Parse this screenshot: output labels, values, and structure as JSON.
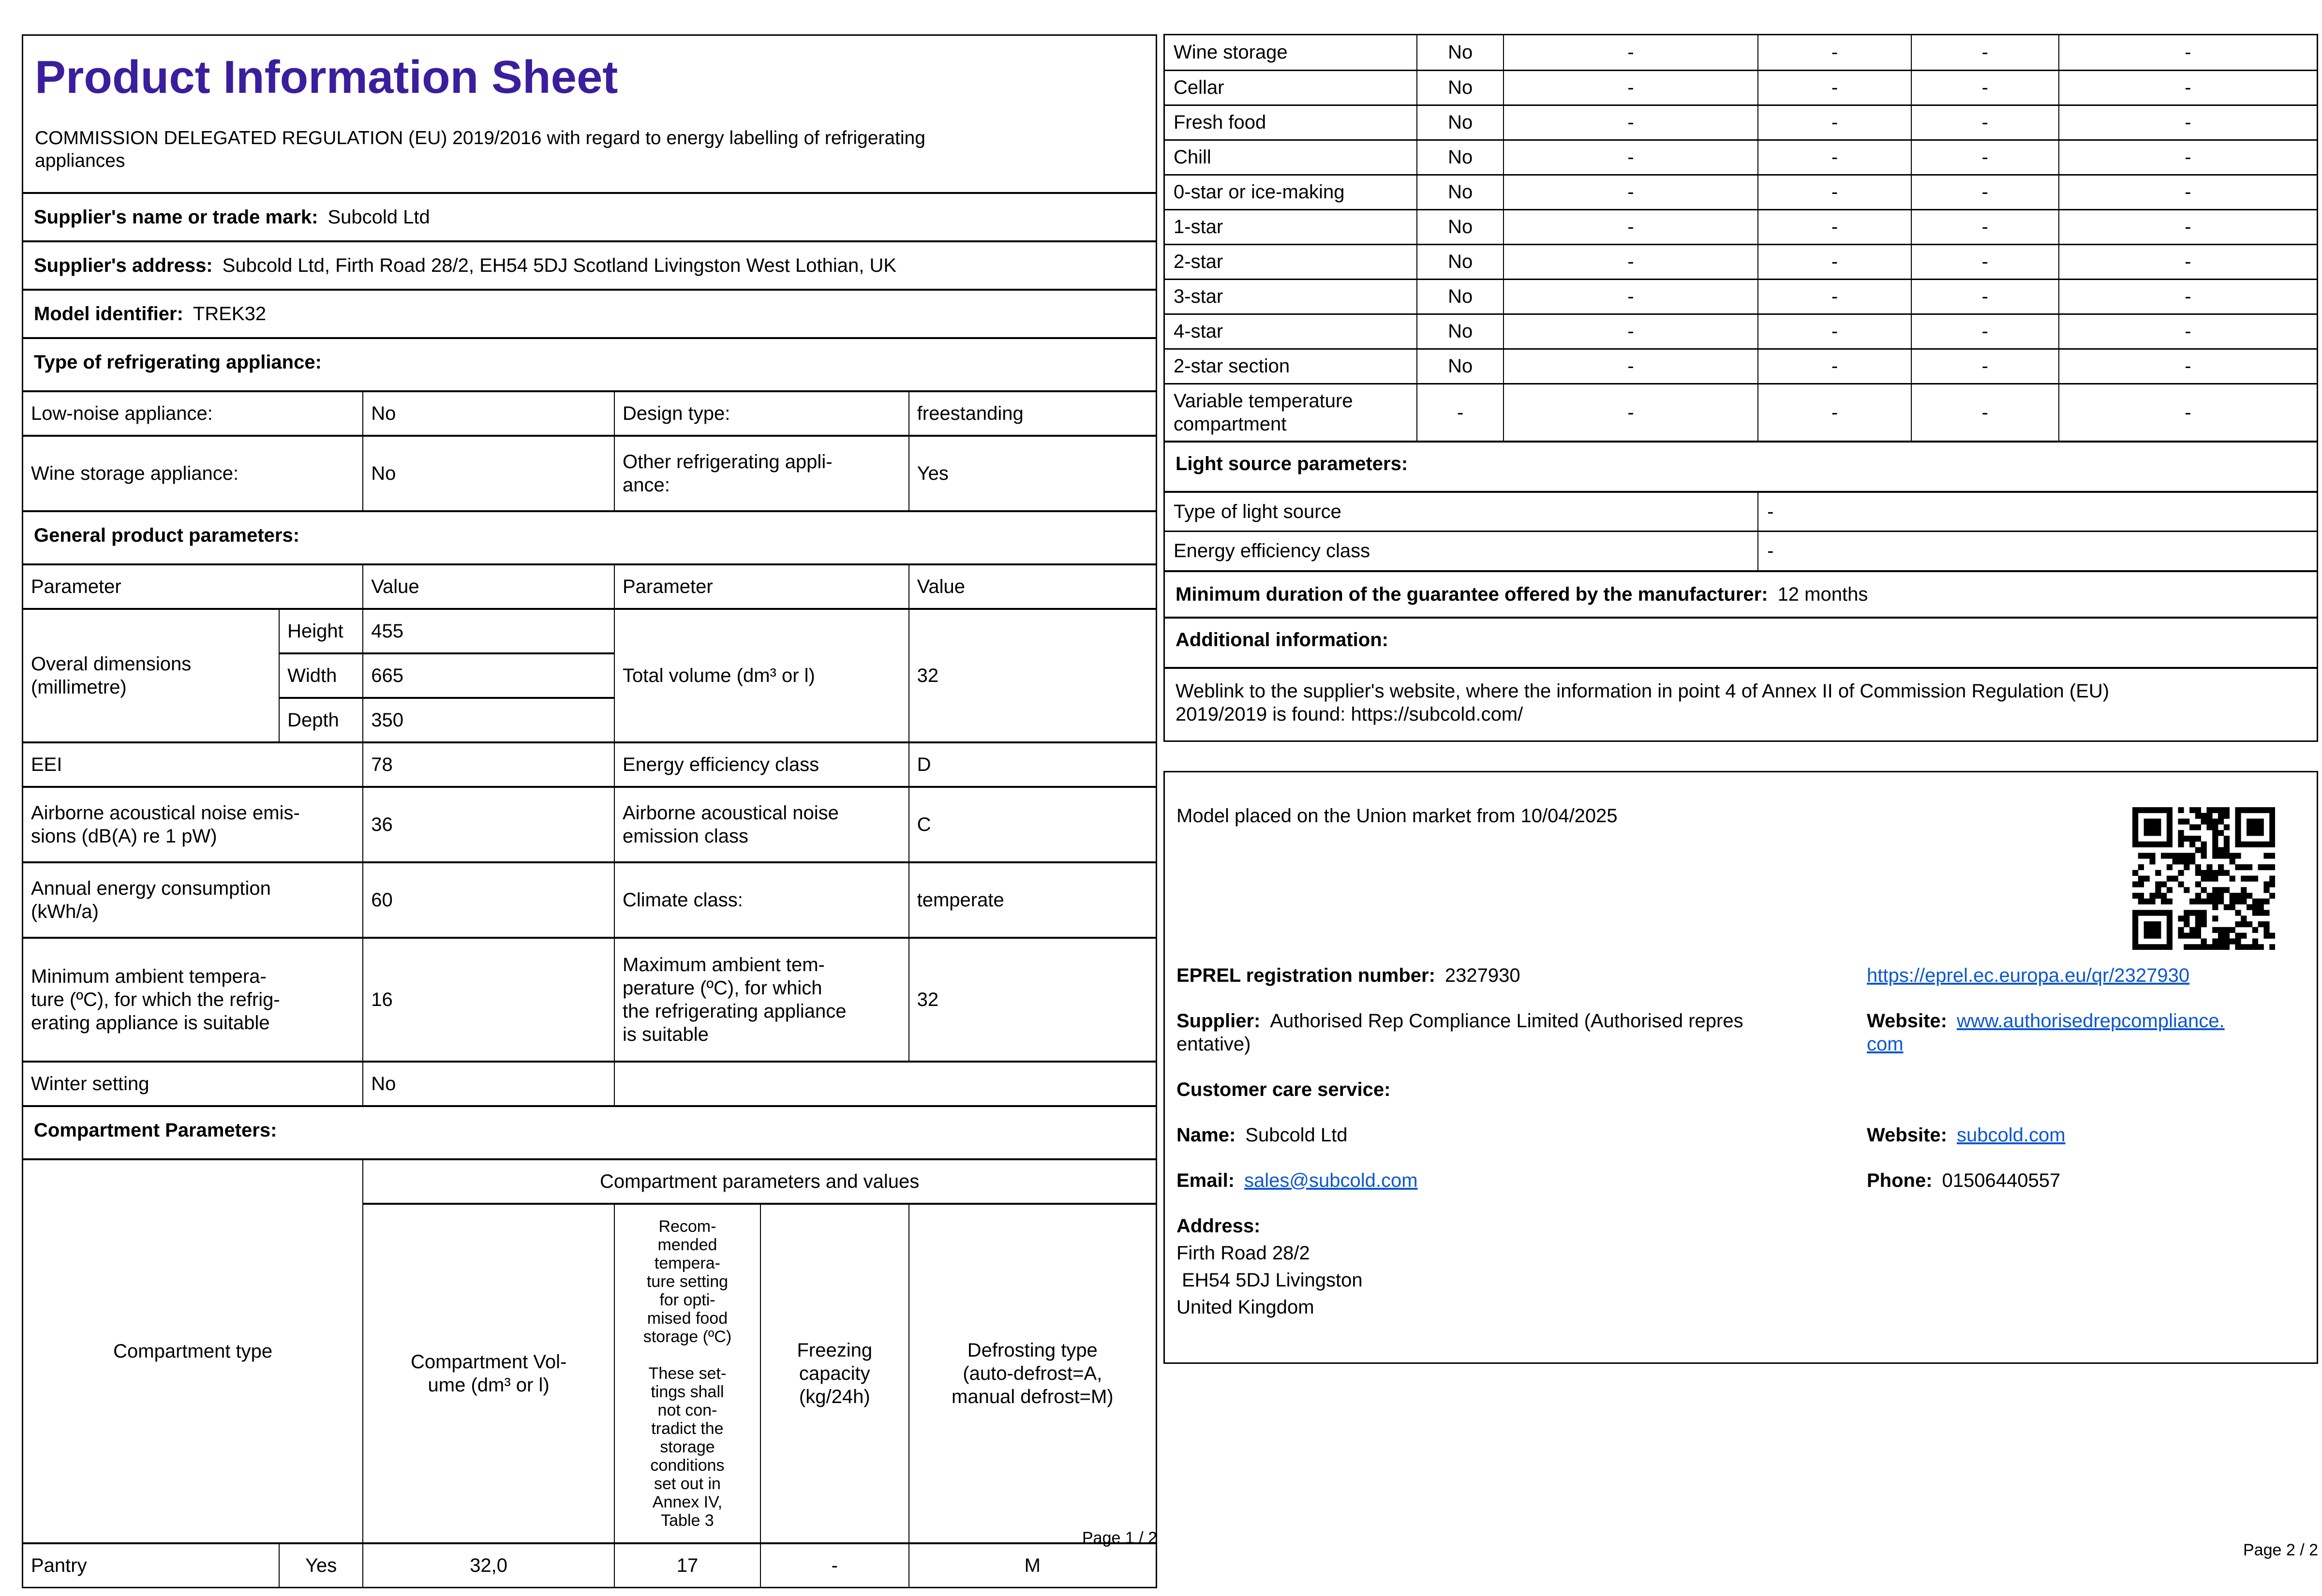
{
  "colors": {
    "title": "#3b1e9d",
    "link": "#0b57d0",
    "text": "#000000"
  },
  "page1": {
    "title": "Product Information Sheet",
    "subtitle": "COMMISSION DELEGATED REGULATION (EU) 2019/2016 with regard to energy labelling of refrigerating\nappliances",
    "supplier_name_label": "Supplier's name or trade mark:",
    "supplier_name_value": "Subcold Ltd",
    "supplier_address_label": "Supplier's address:",
    "supplier_address_value": "Subcold Ltd, Firth Road 28/2, EH54 5DJ Scotland Livingston West Lothian, UK",
    "model_identifier_label": "Model identifier:",
    "model_identifier_value": "TREK32",
    "type_heading": "Type of refrigerating appliance:",
    "type_table": {
      "low_noise_label": "Low-noise appliance:",
      "low_noise_value": "No",
      "design_type_label": "Design type:",
      "design_type_value": "freestanding",
      "wine_storage_label": "Wine storage appliance:",
      "wine_storage_value": "No",
      "other_appliance_label": "Other refrigerating appli-\nance:",
      "other_appliance_value": "Yes"
    },
    "general_heading": "General product parameters:",
    "general_table": {
      "col_parameter": "Parameter",
      "col_value": "Value",
      "dims_label": "Overal dimensions\n(millimetre)",
      "dims_rows": [
        {
          "k": "Height",
          "v": "455"
        },
        {
          "k": "Width",
          "v": "665"
        },
        {
          "k": "Depth",
          "v": "350"
        }
      ],
      "total_volume_label": "Total volume (dm³ or l)",
      "total_volume_value": "32",
      "eei_label": "EEI",
      "eei_value": "78",
      "energy_class_label": "Energy efficiency class",
      "energy_class_value": "D",
      "noise_label": "Airborne acoustical noise emis-\nsions (dB(A) re 1 pW)",
      "noise_value": "36",
      "noise_class_label": "Airborne acoustical noise\nemission class",
      "noise_class_value": "C",
      "annual_energy_label": "Annual energy consumption\n(kWh/a)",
      "annual_energy_value": "60",
      "climate_label": "Climate class:",
      "climate_value": "temperate",
      "min_temp_label": "Minimum ambient tempera-\nture (ºC), for which the refrig-\nerating appliance is suitable",
      "min_temp_value": "16",
      "max_temp_label": "Maximum ambient tem-\nperature (ºC), for which\nthe refrigerating appliance\nis suitable",
      "max_temp_value": "32",
      "winter_label": "Winter setting",
      "winter_value": "No"
    },
    "compartment_heading": "Compartment Parameters:",
    "compartment_table": {
      "header_main": "Compartment parameters and values",
      "col_type": "Compartment type",
      "col_volume": "Compartment Vol-\nume (dm³ or l)",
      "col_temp": "Recom-\nmended\ntempera-\nture setting\nfor opti-\nmised food\nstorage (ºC)\n\nThese set-\ntings shall\nnot con-\ntradict the\nstorage\nconditions\nset out in\nAnnex IV,\nTable 3",
      "col_freezing": "Freezing\ncapacity\n(kg/24h)",
      "col_defrost": "Defrosting type\n(auto-defrost=A,\nmanual defrost=M)",
      "row": {
        "type": "Pantry",
        "present": "Yes",
        "volume": "32,0",
        "temp": "17",
        "freezing": "-",
        "defrost": "M"
      }
    },
    "footer": "Page 1 / 2"
  },
  "page2": {
    "compartment_rows": [
      {
        "label": "Wine storage",
        "value": "No",
        "d": [
          "-",
          "-",
          "-",
          "-"
        ]
      },
      {
        "label": "Cellar",
        "value": "No",
        "d": [
          "-",
          "-",
          "-",
          "-"
        ]
      },
      {
        "label": "Fresh food",
        "value": "No",
        "d": [
          "-",
          "-",
          "-",
          "-"
        ]
      },
      {
        "label": "Chill",
        "value": "No",
        "d": [
          "-",
          "-",
          "-",
          "-"
        ]
      },
      {
        "label": "0-star or ice-making",
        "value": "No",
        "d": [
          "-",
          "-",
          "-",
          "-"
        ]
      },
      {
        "label": "1-star",
        "value": "No",
        "d": [
          "-",
          "-",
          "-",
          "-"
        ]
      },
      {
        "label": "2-star",
        "value": "No",
        "d": [
          "-",
          "-",
          "-",
          "-"
        ]
      },
      {
        "label": "3-star",
        "value": "No",
        "d": [
          "-",
          "-",
          "-",
          "-"
        ]
      },
      {
        "label": "4-star",
        "value": "No",
        "d": [
          "-",
          "-",
          "-",
          "-"
        ]
      },
      {
        "label": "2-star section",
        "value": "No",
        "d": [
          "-",
          "-",
          "-",
          "-"
        ]
      },
      {
        "label": "Variable temperature\ncompartment",
        "value": "-",
        "d": [
          "-",
          "-",
          "-",
          "-"
        ]
      }
    ],
    "light_heading": "Light source parameters:",
    "light_type_label": "Type of light source",
    "light_type_value": "-",
    "light_class_label": "Energy efficiency class",
    "light_class_value": "-",
    "guarantee_label": "Minimum duration of the guarantee offered by the manufacturer:",
    "guarantee_value": "12 months",
    "additional_heading": "Additional information:",
    "weblink_text": "Weblink to the supplier's website, where the information in point 4 of Annex II of Commission Regulation (EU)\n2019/2019 is found:  https://subcold.com/",
    "market_box": {
      "model_placed": "Model placed on the Union market from 10/04/2025",
      "eprel_label": "EPREL registration number:",
      "eprel_value": "2327930",
      "eprel_link": "https://eprel.ec.europa.eu/qr/2327930",
      "supplier_label": "Supplier:",
      "supplier_value": "Authorised Rep Compliance Limited (Authorised repres\nentative)",
      "website_label": "Website:",
      "website_value": "www.authorisedrepcompliance.\ncom",
      "customer_care_heading": "Customer care service:",
      "name_label": "Name:",
      "name_value": "Subcold Ltd",
      "care_website_label": "Website:",
      "care_website_value": "subcold.com",
      "email_label": "Email:",
      "email_value": "sales@subcold.com",
      "phone_label": "Phone:",
      "phone_value": "01506440557",
      "address_label": "Address:",
      "address_lines": [
        "Firth Road 28/2",
        " EH54 5DJ Livingston",
        "United Kingdom"
      ]
    },
    "footer": "Page 2 / 2"
  }
}
